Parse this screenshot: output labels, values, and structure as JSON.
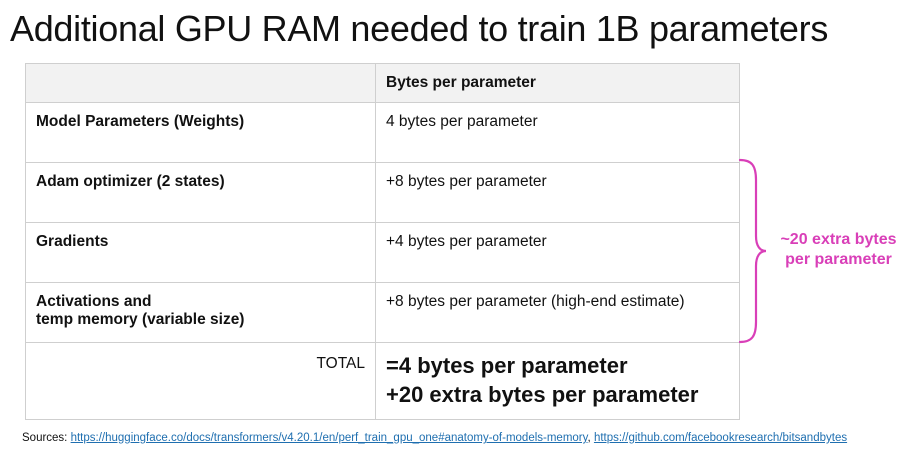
{
  "title": "Additional GPU RAM needed to train 1B parameters",
  "table": {
    "header": [
      "",
      "Bytes per parameter"
    ],
    "rows": [
      {
        "label": [
          "Model Parameters (Weights)"
        ],
        "value": "4 bytes per parameter"
      },
      {
        "label": [
          "Adam optimizer (2 states)"
        ],
        "value": "+8 bytes per parameter"
      },
      {
        "label": [
          "Gradients"
        ],
        "value": "+4 bytes per parameter"
      },
      {
        "label": [
          "Activations and",
          "temp memory (variable size)"
        ],
        "value": "+8 bytes per parameter (high-end estimate)"
      }
    ],
    "total": {
      "label": "TOTAL",
      "lines": [
        "=4 bytes per parameter",
        "+20 extra bytes per parameter"
      ]
    }
  },
  "annotation": {
    "lines": [
      "~20 extra bytes",
      "per parameter"
    ],
    "color": "#d93fb8"
  },
  "sources": {
    "label": "Sources:",
    "link1": "https://huggingface.co/docs/transformers/v4.20.1/en/perf_train_gpu_one#anatomy-of-models-memory",
    "separator": ",",
    "link2": "https://github.com/facebookresearch/bitsandbytes"
  }
}
